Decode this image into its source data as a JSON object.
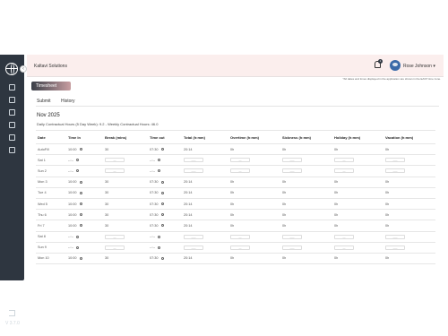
{
  "sidebar": {
    "version": "V 3.7.0",
    "items": [
      "dashboard-icon",
      "document-icon",
      "copy-icon",
      "chart-icon",
      "calendar-icon",
      "file-icon"
    ]
  },
  "header": {
    "company": "Kaltavi Solutions",
    "notification_count": "1",
    "user_name": "Rose Johnson",
    "timezone_note": "*All dates and times displayed in the application are shown in the EAST time zone."
  },
  "page": {
    "badge": "Timesheet",
    "tabs": [
      {
        "label": "Submit"
      },
      {
        "label": "History"
      }
    ],
    "month": "Nov 2025",
    "contract_hours": "Daily Contractual Hours (5 Day Week): 9.2 - Weekly Contractual Hours: 46.0"
  },
  "table": {
    "headers": [
      "Date",
      "Time In",
      "Break (mins)",
      "Time out",
      "Total (h:mm)",
      "Overtime (h:mm)",
      "Sickness (h:mm)",
      "Holiday (h:mm)",
      "Vacation (h:mm)"
    ],
    "rows": [
      {
        "date": "AutoFill",
        "in": "10:00",
        "brk": "30",
        "out": "07:30",
        "total": "20:14",
        "ot": "0h",
        "sick": "0h",
        "hol": "0h",
        "vac": "0h",
        "empty": false
      },
      {
        "date": "Sat 1",
        "in": "--:--",
        "brk": "---",
        "out": "--:--",
        "total": "-----",
        "ot": "---",
        "sick": "-----",
        "hol": "---",
        "vac": "-----",
        "empty": true
      },
      {
        "date": "Sun 2",
        "in": "--:--",
        "brk": "---",
        "out": "--:--",
        "total": "-----",
        "ot": "---",
        "sick": "-----",
        "hol": "---",
        "vac": "-----",
        "empty": true
      },
      {
        "date": "Mon 3",
        "in": "10:00",
        "brk": "30",
        "out": "07:30",
        "total": "20:14",
        "ot": "0h",
        "sick": "0h",
        "hol": "0h",
        "vac": "0h",
        "empty": false
      },
      {
        "date": "Tue 4",
        "in": "10:00",
        "brk": "30",
        "out": "07:30",
        "total": "20:14",
        "ot": "0h",
        "sick": "0h",
        "hol": "0h",
        "vac": "0h",
        "empty": false
      },
      {
        "date": "Wed 5",
        "in": "10:00",
        "brk": "30",
        "out": "07:30",
        "total": "20:14",
        "ot": "0h",
        "sick": "0h",
        "hol": "0h",
        "vac": "0h",
        "empty": false
      },
      {
        "date": "Thu 6",
        "in": "10:00",
        "brk": "30",
        "out": "07:30",
        "total": "20:14",
        "ot": "0h",
        "sick": "0h",
        "hol": "0h",
        "vac": "0h",
        "empty": false
      },
      {
        "date": "Fri 7",
        "in": "10:00",
        "brk": "30",
        "out": "07:30",
        "total": "20:14",
        "ot": "0h",
        "sick": "0h",
        "hol": "0h",
        "vac": "0h",
        "empty": false
      },
      {
        "date": "Sat 8",
        "in": "--:--",
        "brk": "---",
        "out": "--:--",
        "total": "-----",
        "ot": "---",
        "sick": "-----",
        "hol": "---",
        "vac": "-----",
        "empty": true
      },
      {
        "date": "Sun 9",
        "in": "--:--",
        "brk": "---",
        "out": "--:--",
        "total": "-----",
        "ot": "---",
        "sick": "-----",
        "hol": "---",
        "vac": "-----",
        "empty": true
      },
      {
        "date": "Mon 10",
        "in": "10:00",
        "brk": "30",
        "out": "07:30",
        "total": "20:14",
        "ot": "0h",
        "sick": "0h",
        "hol": "0h",
        "vac": "0h",
        "empty": false
      }
    ]
  }
}
